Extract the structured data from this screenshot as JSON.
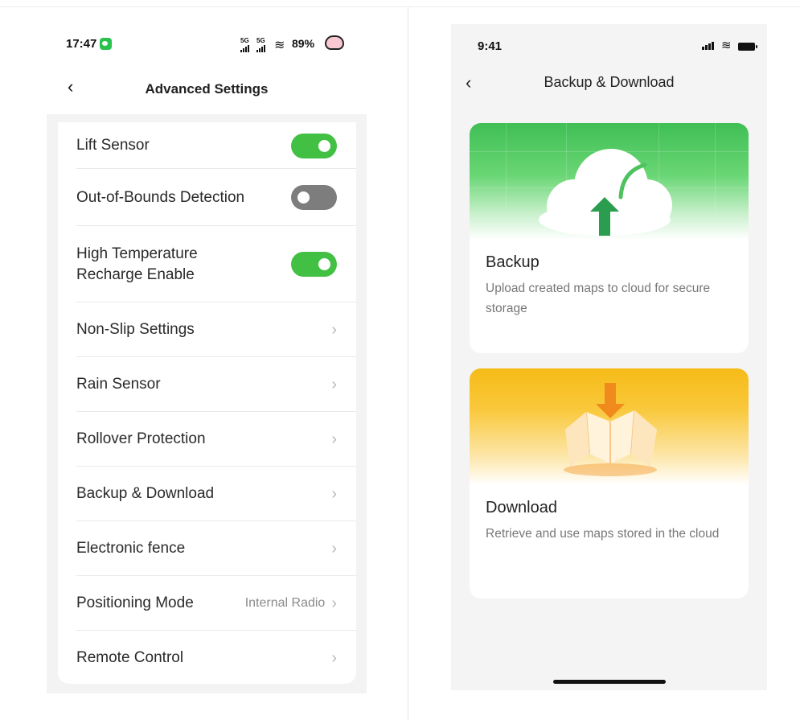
{
  "left": {
    "status": {
      "time": "17:47",
      "network_a": "5G",
      "network_b": "5G",
      "battery": "89%"
    },
    "title": "Advanced Settings",
    "rows": [
      {
        "label": "Lift Sensor",
        "kind": "toggle",
        "state": "on"
      },
      {
        "label": "Out-of-Bounds Detection",
        "kind": "toggle",
        "state": "off"
      },
      {
        "label": "High Temperature\nRecharge Enable",
        "kind": "toggle",
        "state": "on"
      },
      {
        "label": "Non-Slip Settings",
        "kind": "link"
      },
      {
        "label": "Rain Sensor",
        "kind": "link"
      },
      {
        "label": "Rollover Protection",
        "kind": "link"
      },
      {
        "label": "Backup & Download",
        "kind": "link"
      },
      {
        "label": "Electronic fence",
        "kind": "link"
      },
      {
        "label": "Positioning Mode",
        "kind": "link",
        "value": "Internal Radio"
      },
      {
        "label": "Remote Control",
        "kind": "link"
      }
    ]
  },
  "right": {
    "status": {
      "time": "9:41"
    },
    "title": "Backup & Download",
    "cards": [
      {
        "title": "Backup",
        "description": "Upload created maps to cloud for secure storage",
        "icon": "cloud-upload-icon"
      },
      {
        "title": "Download",
        "description": "Retrieve and use maps stored in the cloud",
        "icon": "map-download-icon"
      }
    ]
  },
  "colors": {
    "toggle_on": "#42c043",
    "toggle_off": "#7d7d7d",
    "backup_banner": "#3fbf54",
    "download_banner": "#f6bb17",
    "arrow_green": "#2a9d4e",
    "arrow_orange": "#f18a1d"
  }
}
